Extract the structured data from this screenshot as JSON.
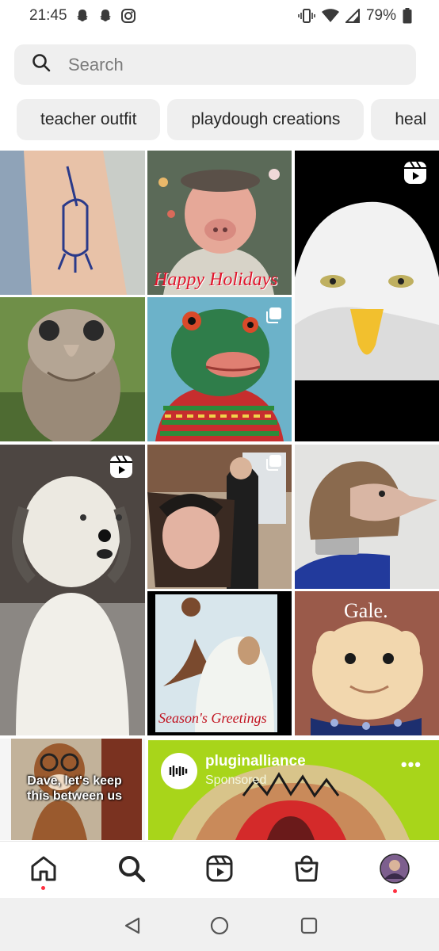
{
  "status_bar": {
    "time": "21:45",
    "battery": "79%",
    "left_icons": [
      "snapchat-icon",
      "snapchat-icon",
      "instagram-icon"
    ],
    "right_icons": [
      "vibrate-icon",
      "wifi-icon",
      "signal-icon",
      "battery-icon"
    ]
  },
  "search": {
    "placeholder": "Search",
    "icon": "search-icon"
  },
  "chips": [
    {
      "label": "teacher outfit"
    },
    {
      "label": "playdough creations"
    },
    {
      "label": "heal"
    }
  ],
  "grid": {
    "tiles": [
      {
        "subject": "arm tattoo of a gnome",
        "badge": null,
        "caption": ""
      },
      {
        "subject": "pig-faced man in flat cap",
        "badge": null,
        "caption": "Happy Holidays"
      },
      {
        "subject": "bald eagle with human eyes",
        "badge": "reels-icon",
        "caption": ""
      },
      {
        "subject": "wet owl with human face",
        "badge": null,
        "caption": ""
      },
      {
        "subject": "green frog puppet in sweater",
        "badge": "carousel-icon",
        "caption": ""
      },
      {
        "subject": "old english sheepdog",
        "badge": "reels-icon",
        "caption": ""
      },
      {
        "subject": "man holding painting",
        "badge": "carousel-icon",
        "caption": ""
      },
      {
        "subject": "long-nosed bob haircut sculpture",
        "badge": null,
        "caption": ""
      },
      {
        "subject": "yeti greeting card",
        "badge": null,
        "caption": "Season's Greetings"
      },
      {
        "subject": "clay doll face",
        "badge": null,
        "caption": "Gale."
      },
      {
        "subject": "chipmunk meme",
        "badge": null,
        "caption": "Dave, let's keep this between us"
      }
    ],
    "ad": {
      "account": "pluginalliance",
      "label": "Sponsored",
      "menu": "•••",
      "colors": {
        "background": "#a8d51a",
        "accent": "#d42a2a"
      }
    }
  },
  "bottom_nav": [
    {
      "name": "home-icon",
      "active": false,
      "dot": true
    },
    {
      "name": "search-icon",
      "active": true,
      "dot": false
    },
    {
      "name": "reels-icon",
      "active": false,
      "dot": false
    },
    {
      "name": "shop-icon",
      "active": false,
      "dot": false
    },
    {
      "name": "profile-avatar",
      "active": false,
      "dot": true
    }
  ],
  "system_nav": [
    "back-icon",
    "home-circle-icon",
    "recents-icon"
  ],
  "colors": {
    "chip_bg": "#efefef",
    "search_bg": "#efefef",
    "notification_dot": "#ff3040",
    "text": "#262626"
  }
}
